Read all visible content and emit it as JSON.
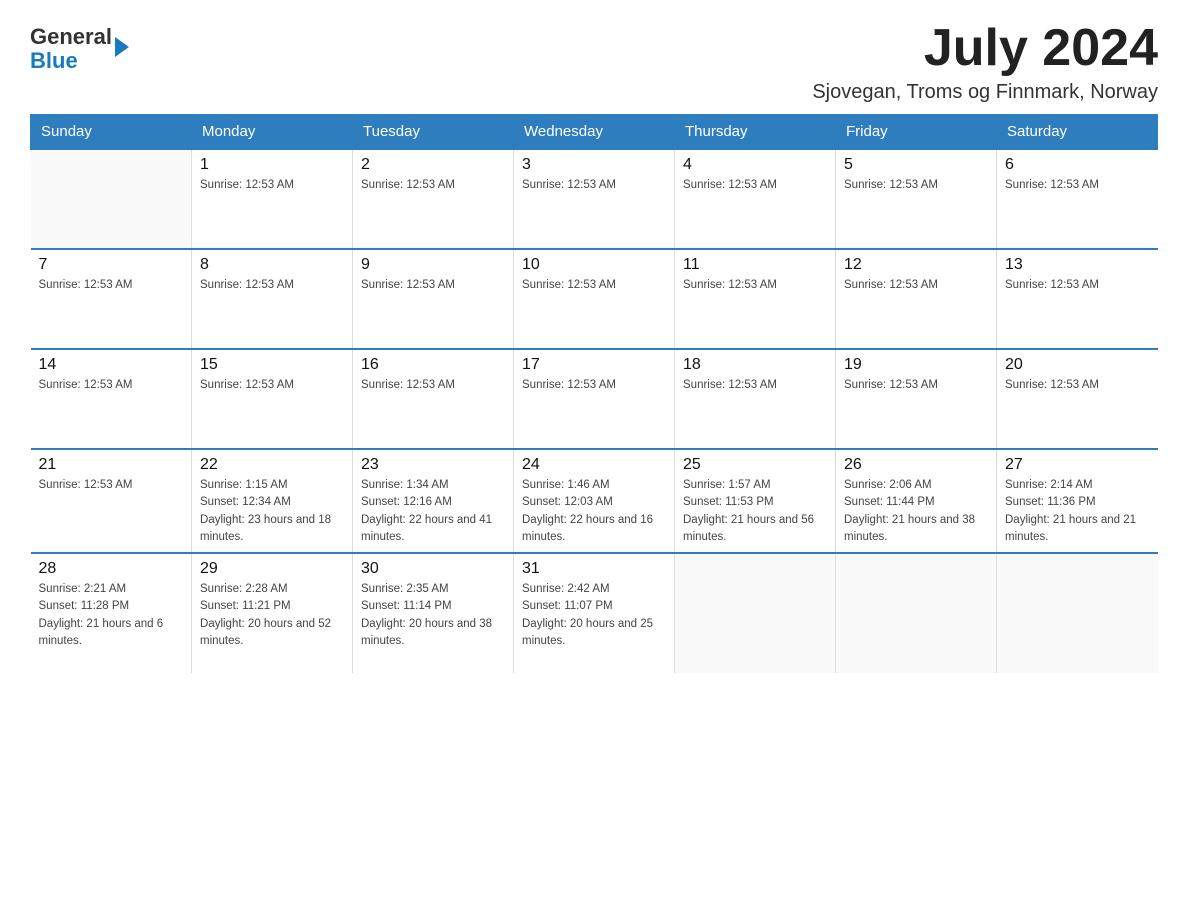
{
  "header": {
    "logo_text_general": "General",
    "logo_text_blue": "Blue",
    "month_year": "July 2024",
    "location": "Sjovegan, Troms og Finnmark, Norway"
  },
  "weekdays": [
    "Sunday",
    "Monday",
    "Tuesday",
    "Wednesday",
    "Thursday",
    "Friday",
    "Saturday"
  ],
  "weeks": [
    [
      {
        "day": "",
        "info": ""
      },
      {
        "day": "1",
        "info": "Sunrise: 12:53 AM"
      },
      {
        "day": "2",
        "info": "Sunrise: 12:53 AM"
      },
      {
        "day": "3",
        "info": "Sunrise: 12:53 AM"
      },
      {
        "day": "4",
        "info": "Sunrise: 12:53 AM"
      },
      {
        "day": "5",
        "info": "Sunrise: 12:53 AM"
      },
      {
        "day": "6",
        "info": "Sunrise: 12:53 AM"
      }
    ],
    [
      {
        "day": "7",
        "info": "Sunrise: 12:53 AM"
      },
      {
        "day": "8",
        "info": "Sunrise: 12:53 AM"
      },
      {
        "day": "9",
        "info": "Sunrise: 12:53 AM"
      },
      {
        "day": "10",
        "info": "Sunrise: 12:53 AM"
      },
      {
        "day": "11",
        "info": "Sunrise: 12:53 AM"
      },
      {
        "day": "12",
        "info": "Sunrise: 12:53 AM"
      },
      {
        "day": "13",
        "info": "Sunrise: 12:53 AM"
      }
    ],
    [
      {
        "day": "14",
        "info": "Sunrise: 12:53 AM"
      },
      {
        "day": "15",
        "info": "Sunrise: 12:53 AM"
      },
      {
        "day": "16",
        "info": "Sunrise: 12:53 AM"
      },
      {
        "day": "17",
        "info": "Sunrise: 12:53 AM"
      },
      {
        "day": "18",
        "info": "Sunrise: 12:53 AM"
      },
      {
        "day": "19",
        "info": "Sunrise: 12:53 AM"
      },
      {
        "day": "20",
        "info": "Sunrise: 12:53 AM"
      }
    ],
    [
      {
        "day": "21",
        "info": "Sunrise: 12:53 AM"
      },
      {
        "day": "22",
        "info": "Sunrise: 1:15 AM\nSunset: 12:34 AM\nDaylight: 23 hours and 18 minutes."
      },
      {
        "day": "23",
        "info": "Sunrise: 1:34 AM\nSunset: 12:16 AM\nDaylight: 22 hours and 41 minutes."
      },
      {
        "day": "24",
        "info": "Sunrise: 1:46 AM\nSunset: 12:03 AM\nDaylight: 22 hours and 16 minutes."
      },
      {
        "day": "25",
        "info": "Sunrise: 1:57 AM\nSunset: 11:53 PM\nDaylight: 21 hours and 56 minutes."
      },
      {
        "day": "26",
        "info": "Sunrise: 2:06 AM\nSunset: 11:44 PM\nDaylight: 21 hours and 38 minutes."
      },
      {
        "day": "27",
        "info": "Sunrise: 2:14 AM\nSunset: 11:36 PM\nDaylight: 21 hours and 21 minutes."
      }
    ],
    [
      {
        "day": "28",
        "info": "Sunrise: 2:21 AM\nSunset: 11:28 PM\nDaylight: 21 hours and 6 minutes."
      },
      {
        "day": "29",
        "info": "Sunrise: 2:28 AM\nSunset: 11:21 PM\nDaylight: 20 hours and 52 minutes."
      },
      {
        "day": "30",
        "info": "Sunrise: 2:35 AM\nSunset: 11:14 PM\nDaylight: 20 hours and 38 minutes."
      },
      {
        "day": "31",
        "info": "Sunrise: 2:42 AM\nSunset: 11:07 PM\nDaylight: 20 hours and 25 minutes."
      },
      {
        "day": "",
        "info": ""
      },
      {
        "day": "",
        "info": ""
      },
      {
        "day": "",
        "info": ""
      }
    ]
  ]
}
